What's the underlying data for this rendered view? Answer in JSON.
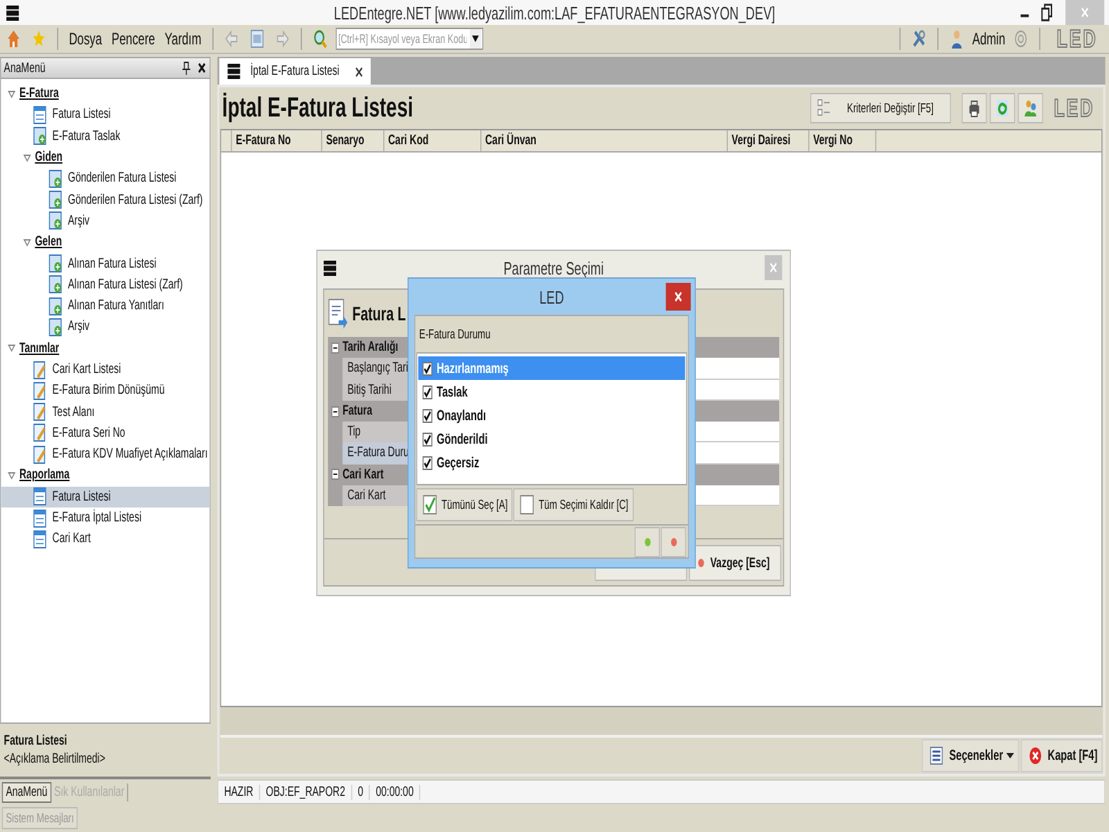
{
  "window": {
    "title": "LEDEntegre.NET [www.ledyazilim.com:LAF_EFATURAENTEGRASYON_DEV]"
  },
  "toolbar": {
    "menus": [
      "Dosya",
      "Pencere",
      "Yardım"
    ],
    "search": {
      "placeholder": "[Ctrl+R] Kısayol veya Ekran Kodu"
    },
    "user": "Admin",
    "logo": "LED"
  },
  "sidebar": {
    "title": "AnaMenü",
    "tree": [
      {
        "label": "E-Fatura",
        "kind": "group",
        "expanded": true,
        "selected": false,
        "children": [
          {
            "label": "Fatura Listesi",
            "kind": "list",
            "selected": false
          },
          {
            "label": "E-Fatura Taslak",
            "kind": "doc",
            "selected": false
          },
          {
            "label": "Giden",
            "kind": "group",
            "expanded": true,
            "selected": false,
            "children": [
              {
                "label": "Gönderilen Fatura Listesi",
                "kind": "doc",
                "selected": false
              },
              {
                "label": "Gönderilen Fatura Listesi (Zarf)",
                "kind": "doc",
                "selected": false
              },
              {
                "label": "Arşiv",
                "kind": "doc",
                "selected": false
              }
            ]
          },
          {
            "label": "Gelen",
            "kind": "group",
            "expanded": true,
            "selected": false,
            "children": [
              {
                "label": "Alınan Fatura Listesi",
                "kind": "doc",
                "selected": false
              },
              {
                "label": "Alınan Fatura Listesi (Zarf)",
                "kind": "doc",
                "selected": false
              },
              {
                "label": "Alınan Fatura Yanıtları",
                "kind": "doc",
                "selected": false
              },
              {
                "label": "Arşiv",
                "kind": "doc",
                "selected": false
              }
            ]
          }
        ]
      },
      {
        "label": "Tanımlar",
        "kind": "group",
        "expanded": true,
        "selected": false,
        "children": [
          {
            "label": "Cari Kart Listesi",
            "kind": "edit",
            "selected": false
          },
          {
            "label": "E-Fatura Birim Dönüşümü",
            "kind": "edit",
            "selected": false
          },
          {
            "label": "Test Alanı",
            "kind": "edit",
            "selected": false
          },
          {
            "label": "E-Fatura Seri No",
            "kind": "edit",
            "selected": false
          },
          {
            "label": "E-Fatura KDV Muafiyet Açıklamaları",
            "kind": "edit",
            "selected": false
          }
        ]
      },
      {
        "label": "Raporlama",
        "kind": "group",
        "expanded": true,
        "selected": false,
        "children": [
          {
            "label": "Fatura Listesi",
            "kind": "list",
            "selected": true
          },
          {
            "label": "E-Fatura İptal Listesi",
            "kind": "list",
            "selected": false
          },
          {
            "label": "Cari Kart",
            "kind": "list",
            "selected": false
          }
        ]
      }
    ],
    "description": {
      "title": "Fatura Listesi",
      "text": "<Açıklama Belirtilmedi>"
    },
    "tabs": [
      {
        "label": "AnaMenü",
        "selected": true
      },
      {
        "label": "Sık Kullanılanlar",
        "selected": false
      }
    ]
  },
  "document_tabs": [
    {
      "label": "İptal E-Fatura Listesi",
      "selected": true
    }
  ],
  "page": {
    "title": "İptal E-Fatura Listesi",
    "criteria_button": "Kriterleri Değiştir [F5]",
    "logo": "LED",
    "columns": [
      "E-Fatura No",
      "Senaryo",
      "Cari Kod",
      "Cari Ünvan",
      "Vergi Dairesi",
      "Vergi No"
    ],
    "options_button": "Seçenekler",
    "close_button": "Kapat [F4]"
  },
  "status_bar": [
    "HAZIR",
    "OBJ:EF_RAPOR2",
    "0",
    "00:00:00"
  ],
  "parameter_dialog": {
    "title": "Parametre Seçimi",
    "heading": "Fatura L",
    "rows": [
      {
        "kind": "category",
        "label": "Tarih Aralığı"
      },
      {
        "kind": "row",
        "label": "Başlangıç Tari",
        "selected": false
      },
      {
        "kind": "row",
        "label": "Bitiş Tarihi",
        "selected": false
      },
      {
        "kind": "category",
        "label": "Fatura"
      },
      {
        "kind": "row",
        "label": "Tip",
        "selected": false
      },
      {
        "kind": "row",
        "label": "E-Fatura Duru",
        "selected": true
      },
      {
        "kind": "category",
        "label": "Cari Kart"
      },
      {
        "kind": "row",
        "label": "Cari Kart",
        "selected": false
      }
    ],
    "cancel_button": "Vazgeç [Esc]"
  },
  "led_dialog": {
    "title": "LED",
    "label": "E-Fatura Durumu",
    "items": [
      {
        "label": "Hazırlanmamış",
        "checked": true,
        "selected": true
      },
      {
        "label": "Taslak",
        "checked": true,
        "selected": false
      },
      {
        "label": "Onaylandı",
        "checked": true,
        "selected": false
      },
      {
        "label": "Gönderildi",
        "checked": true,
        "selected": false
      },
      {
        "label": "Geçersiz",
        "checked": true,
        "selected": false
      }
    ],
    "select_all_button": "Tümünü Seç [A]",
    "clear_button": "Tüm Seçimi Kaldır [C]"
  },
  "system_messages_button": "Sistem Mesajları"
}
